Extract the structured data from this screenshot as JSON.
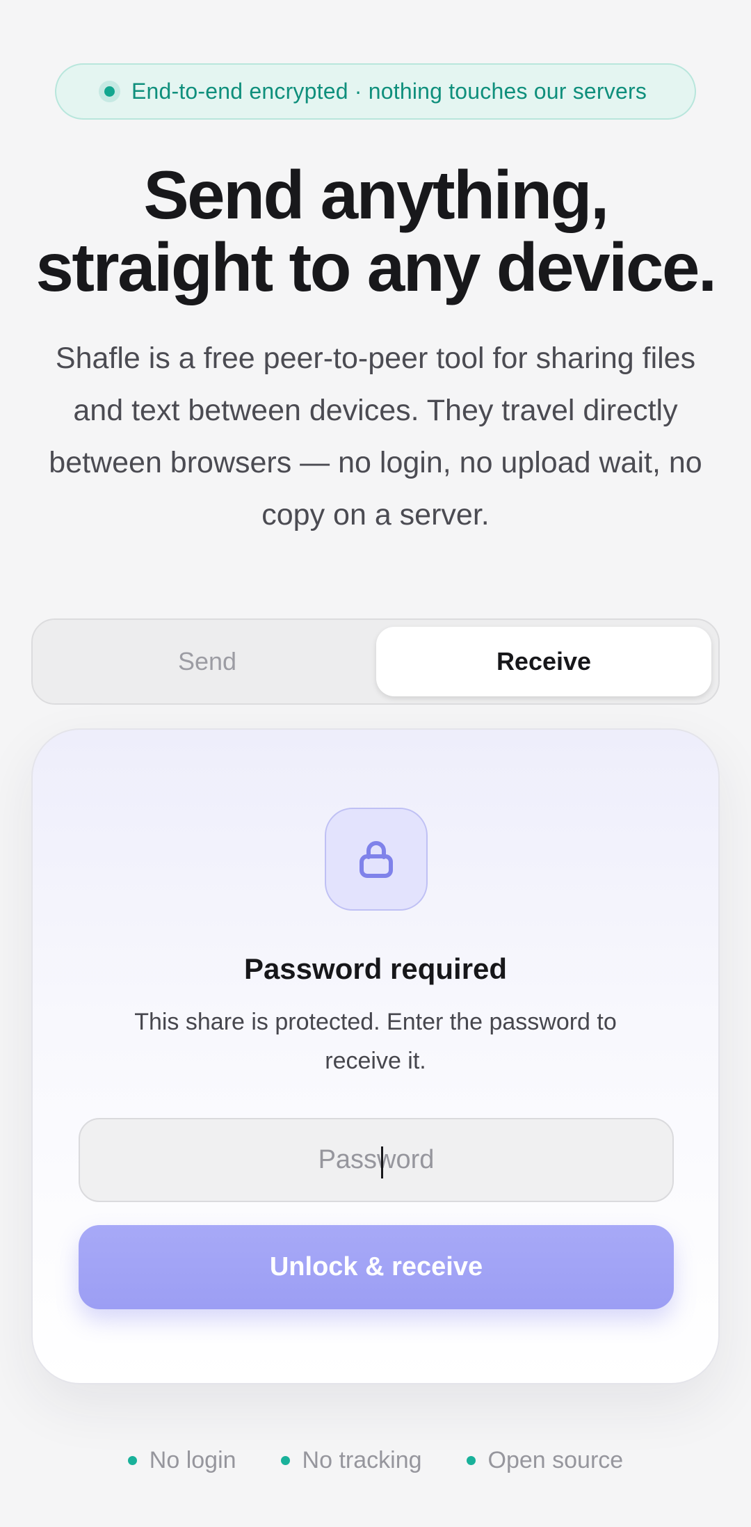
{
  "badge": {
    "text": "End-to-end encrypted · nothing touches our servers",
    "dot_color": "#12a68f"
  },
  "hero": {
    "title_line1": "Send anything,",
    "title_line2": "straight to any device.",
    "subtitle": "Shafle is a free peer-to-peer tool for sharing files and text between devices. They travel directly between browsers — no login, no upload wait, no copy on a server."
  },
  "tabs": {
    "send_label": "Send",
    "receive_label": "Receive",
    "active": "Receive"
  },
  "card": {
    "icon": "lock-icon",
    "title": "Password required",
    "description": "This share is protected. Enter the password to receive it.",
    "password_placeholder": "Password",
    "password_value": "",
    "button_label": "Unlock & receive",
    "accent_color": "#9c9ef4"
  },
  "features": [
    {
      "label": "No login"
    },
    {
      "label": "No tracking"
    },
    {
      "label": "Open source"
    }
  ],
  "colors": {
    "teal": "#12a68f",
    "indigo": "#8b8def",
    "background": "#f5f5f6"
  }
}
